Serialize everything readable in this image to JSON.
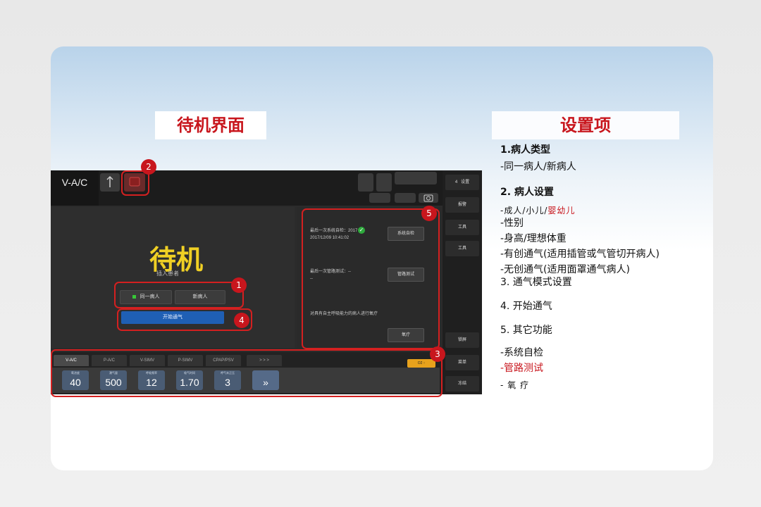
{
  "left_title": "待机界面",
  "right_title": "设置项",
  "screen": {
    "mode_tab": "V-A/C",
    "standby_title": "待机",
    "standby_sub": "插入患者",
    "same_patient_btn": "同一病人",
    "new_patient_btn": "新病人",
    "start_btn": "开始通气",
    "right_panel": {
      "item1_text": "最后一次系统自检：2017",
      "item1_date": "2017/12/09 10:41:02",
      "item1_btn": "系统自检",
      "item2_text": "最后一次管路测试：--",
      "item2_sub": "--",
      "item2_btn": "管路测试",
      "item3_text": "对具有自主呼吸能力的病人进行氧疗",
      "item3_btn": "氧疗"
    },
    "sidebar": {
      "item1_num": "4",
      "item1_label": "设置",
      "item2_label": "报警",
      "item3_label": "工具",
      "item4_label": "锁屏",
      "item5_label": "菜单",
      "item6_label": "冻结"
    },
    "bottom_tabs": [
      "V-A/C",
      "P-A/C",
      "V-SIMV",
      "P-SIMV",
      "CPAP/PSV",
      "> > >"
    ],
    "orange_btn": "O2 ↑",
    "params": [
      {
        "label": "氧浓度",
        "value": "40"
      },
      {
        "label": "潮气量",
        "value": "500"
      },
      {
        "label": "呼吸频率",
        "value": "12"
      },
      {
        "label": "吸气时间",
        "value": "1.70"
      },
      {
        "label": "呼气末正压",
        "value": "3"
      },
      {
        "label": "",
        "value": "»"
      }
    ]
  },
  "callouts": [
    "1",
    "2",
    "3",
    "4",
    "5"
  ],
  "settings_list": [
    {
      "text": "1.病人类型",
      "style": "bold"
    },
    {
      "text": "-同一病人/新病人",
      "style": "normal"
    },
    {
      "text": "2. 病人设置",
      "style": "bold"
    },
    {
      "text": "-成人/小儿/",
      "text_red": "婴幼儿",
      "style": "small"
    },
    {
      "text": "-性别",
      "style": "normal"
    },
    {
      "text": "-身高/理想体重",
      "style": "normal"
    },
    {
      "text": "-有创通气(适用插管或气管切开病人)",
      "style": "normal"
    },
    {
      "text": "-无创通气(适用面罩通气病人)",
      "style": "normal"
    },
    {
      "text": "3. 通气模式设置",
      "style": "normal"
    },
    {
      "text": "4. 开始通气",
      "style": "normal"
    },
    {
      "text": "5. 其它功能",
      "style": "normal"
    },
    {
      "text": "-系统自检",
      "style": "normal"
    },
    {
      "text": "-管路测试",
      "style": "red"
    },
    {
      "text": "- 氧 疗",
      "style": "small"
    }
  ]
}
